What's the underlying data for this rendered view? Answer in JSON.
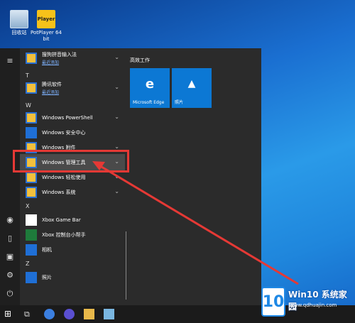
{
  "desktop": {
    "icons": [
      {
        "label": "回收站"
      },
      {
        "label": "PotPlayer 64 bit",
        "badge": "Player"
      }
    ]
  },
  "start_menu": {
    "rail_icons": [
      "hamburger-icon",
      "user-icon",
      "document-icon",
      "pictures-icon",
      "settings-icon",
      "power-icon"
    ],
    "apps": [
      {
        "kind": "item",
        "label": "搜狗拼音输入法",
        "sub": "最近添加",
        "icon": "folder"
      },
      {
        "kind": "letter",
        "label": "T"
      },
      {
        "kind": "item",
        "label": "腾讯软件",
        "sub": "最近添加",
        "icon": "folder"
      },
      {
        "kind": "letter",
        "label": "W"
      },
      {
        "kind": "item",
        "label": "Windows PowerShell",
        "icon": "folder"
      },
      {
        "kind": "item",
        "label": "Windows 安全中心",
        "icon": "shield"
      },
      {
        "kind": "item",
        "label": "Windows 附件",
        "icon": "folder"
      },
      {
        "kind": "item",
        "label": "Windows 管理工具",
        "icon": "folder"
      },
      {
        "kind": "item",
        "label": "Windows 轻松使用",
        "icon": "folder"
      },
      {
        "kind": "item",
        "label": "Windows 系统",
        "icon": "folder"
      },
      {
        "kind": "letter",
        "label": "X"
      },
      {
        "kind": "item",
        "label": "Xbox Game Bar",
        "icon": "xbox"
      },
      {
        "kind": "item",
        "label": "Xbox 控制台小帮手",
        "icon": "xbox"
      },
      {
        "kind": "item",
        "label": "相机",
        "icon": "camera"
      },
      {
        "kind": "letter",
        "label": "Z"
      },
      {
        "kind": "item",
        "label": "照片",
        "icon": "photos"
      }
    ],
    "tiles_group": "高效工作",
    "tiles": [
      {
        "label": "Microsoft Edge",
        "glyph": "e"
      },
      {
        "label": "照片",
        "glyph": "▲"
      }
    ]
  },
  "watermark": {
    "box": "10",
    "title": "Win10 系统家园",
    "url": "www.qdhuajin.com"
  },
  "colors": {
    "highlight": "#e53935",
    "tile": "#0c78d4",
    "menu_bg": "#2b2b2b"
  }
}
